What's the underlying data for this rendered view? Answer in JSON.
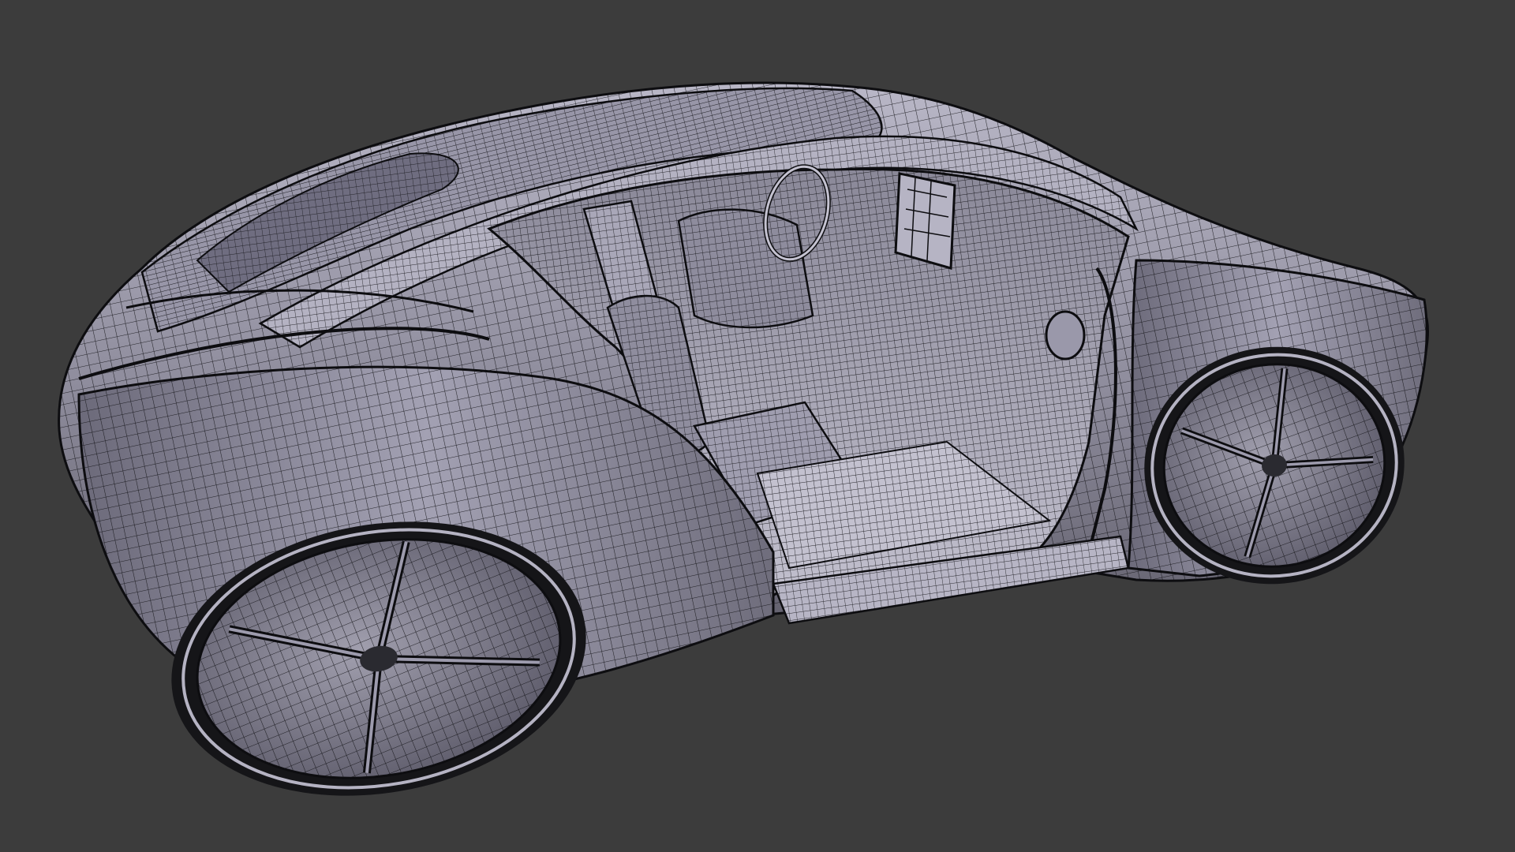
{
  "viewport": {
    "background": "#3c3c3c",
    "mode": "wireframe-on-shaded"
  },
  "model": {
    "type": "car",
    "body_color": "#8e8c9c",
    "body_highlight": "#c9c7d6",
    "body_shadow": "#4a4857",
    "wire_color": "#111111",
    "tire_color": "#1a1a1e"
  }
}
